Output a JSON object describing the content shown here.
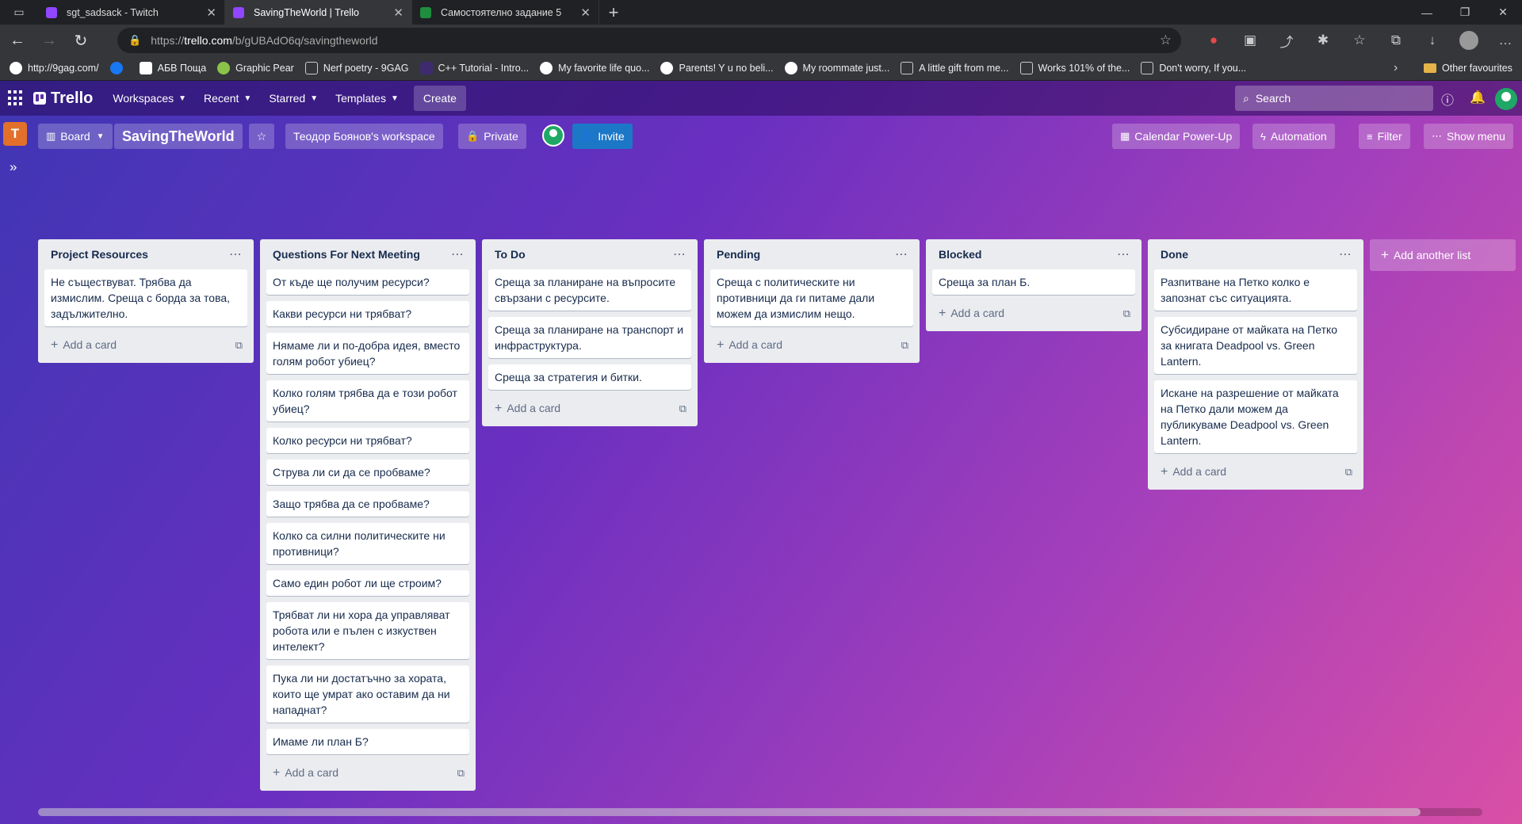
{
  "browser": {
    "tabs": [
      {
        "title": "sgt_sadsack - Twitch",
        "favicon_color": "#9146ff",
        "active": false
      },
      {
        "title": "SavingTheWorld | Trello",
        "favicon_color": "#9146ff",
        "active": true
      },
      {
        "title": "Самостоятелно задание 5",
        "favicon_color": "#1e8e3e",
        "active": false
      }
    ],
    "new_tab": "+",
    "url_prefix": "https://",
    "url_host": "trello.com",
    "url_path": "/b/gUBAdO6q/savingtheworld",
    "bookmarks": [
      {
        "label": "http://9gag.com/",
        "icon": "9gag-icon"
      },
      {
        "label": "",
        "icon": "facebook-icon"
      },
      {
        "label": "АБВ Поща",
        "icon": "abv-icon"
      },
      {
        "label": "Graphic Pear",
        "icon": "graphicpear-icon"
      },
      {
        "label": "Nerf poetry - 9GAG",
        "icon": "page-icon"
      },
      {
        "label": "C++ Tutorial - Intro...",
        "icon": "cpp-icon"
      },
      {
        "label": "My favorite life quo...",
        "icon": "9gag-icon"
      },
      {
        "label": "Parents! Y u no beli...",
        "icon": "9gag-icon"
      },
      {
        "label": "My roommate just...",
        "icon": "9gag-icon"
      },
      {
        "label": "A little gift from me...",
        "icon": "page-icon"
      },
      {
        "label": "Works 101% of the...",
        "icon": "page-icon"
      },
      {
        "label": "Don't worry, If you...",
        "icon": "page-icon"
      }
    ],
    "other_favourites": "Other favourites"
  },
  "trello": {
    "logo": "Trello",
    "nav": [
      "Workspaces",
      "Recent",
      "Starred",
      "Templates"
    ],
    "create": "Create",
    "search_placeholder": "Search"
  },
  "board": {
    "workspace_initial": "T",
    "view": "Board",
    "title": "SavingTheWorld",
    "workspace": "Теодор Боянов's workspace",
    "visibility": "Private",
    "invite": "Invite",
    "calendar": "Calendar Power-Up",
    "automation": "Automation",
    "filter": "Filter",
    "show_menu": "Show menu",
    "add_list": "Add another list",
    "add_card": "Add a card",
    "lists": [
      {
        "title": "Project Resources",
        "cards": [
          "Не съществуват. Трябва да измислим. Среща с борда за това, задължително."
        ]
      },
      {
        "title": "Questions For Next Meeting",
        "cards": [
          "От къде ще получим ресурси?",
          "Какви ресурси ни трябват?",
          "Нямаме ли и по-добра идея, вместо голям робот убиец?",
          "Колко голям трябва да е този робот убиец?",
          "Колко ресурси ни трябват?",
          "Струва ли си да се пробваме?",
          "Защо трябва да се пробваме?",
          "Колко са силни политическите ни противници?",
          "Само един робот ли ще строим?",
          "Трябват ли ни хора да управляват робота или е пълен с изкуствен интелект?",
          "Пука ли ни достатъчно за хората, които ще умрат ако оставим да ни нападнат?",
          "Имаме ли план Б?"
        ]
      },
      {
        "title": "To Do",
        "cards": [
          "Среща за планиране на въпросите свързани с ресурсите.",
          "Среща за планиране на транспорт и инфраструктура.",
          "Среща за стратегия и битки."
        ]
      },
      {
        "title": "Pending",
        "cards": [
          "Среща с политическите ни противници да ги питаме дали можем да измислим нещо."
        ]
      },
      {
        "title": "Blocked",
        "cards": [
          "Среща за план Б."
        ]
      },
      {
        "title": "Done",
        "cards": [
          "Разпитване на Петко колко е запознат със ситуацията.",
          "Субсидиране от майката на Петко за книгата Deadpool vs. Green Lantern.",
          "Искане на разрешение от майката на Петко дали можем да публикуваме Deadpool vs. Green Lantern."
        ]
      }
    ]
  }
}
